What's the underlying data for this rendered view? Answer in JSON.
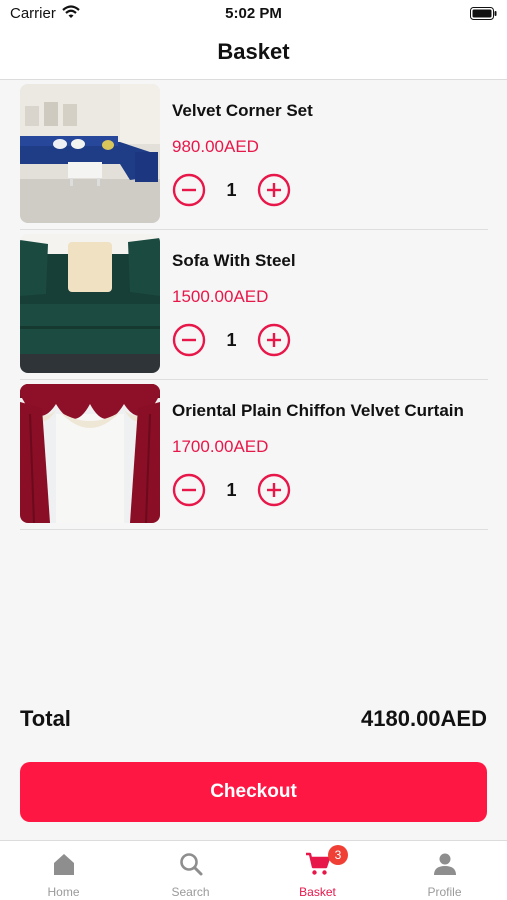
{
  "status_bar": {
    "carrier": "Carrier",
    "time": "5:02 PM"
  },
  "header": {
    "title": "Basket"
  },
  "basket": {
    "items": [
      {
        "name": "Velvet Corner Set",
        "price": "980.00AED",
        "quantity": "1",
        "image": "blue-velvet-corner-sofa"
      },
      {
        "name": "Sofa With Steel",
        "price": "1500.00AED",
        "quantity": "1",
        "image": "green-velvet-sofa"
      },
      {
        "name": "Oriental Plain Chiffon Velvet Curtain",
        "price": "1700.00AED",
        "quantity": "1",
        "image": "burgundy-velvet-curtain"
      }
    ]
  },
  "summary": {
    "total_label": "Total",
    "total_value": "4180.00AED"
  },
  "checkout": {
    "label": "Checkout"
  },
  "tab_bar": {
    "items": [
      {
        "label": "Home",
        "icon": "home-icon"
      },
      {
        "label": "Search",
        "icon": "search-icon"
      },
      {
        "label": "Basket",
        "icon": "cart-icon",
        "badge": "3",
        "active": true
      },
      {
        "label": "Profile",
        "icon": "person-icon"
      }
    ]
  },
  "colors": {
    "accent": "#ff1744",
    "price": "#e8174a",
    "badge": "#f04036",
    "inactive_tab": "#9a9a9a"
  }
}
